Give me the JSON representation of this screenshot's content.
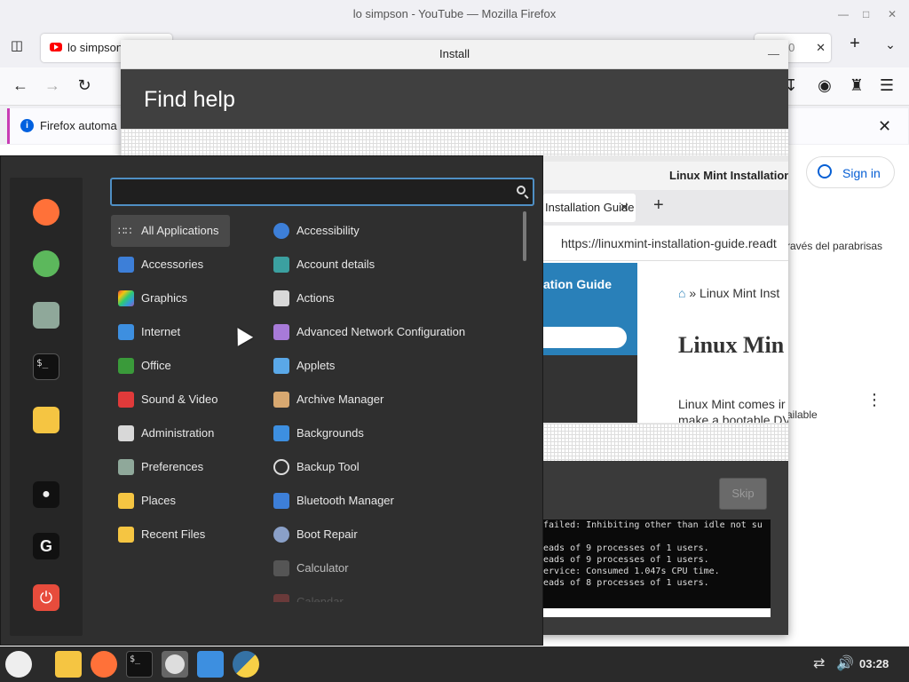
{
  "firefox": {
    "window_title": "lo simpson - YouTube — Mozilla Firefox",
    "tab_label": "lo simpson",
    "tab_partial": "t_20",
    "info_text": "Firefox automa",
    "sign_in": "Sign in",
    "stray_text_1": "ravés del parabrisas",
    "stray_text_2": "ailable"
  },
  "installer": {
    "title": "Install",
    "header": "Find help",
    "skip_label": "Skip",
    "guide": {
      "window_title": "Linux Mint Installation",
      "tab_label": "Installation Guide",
      "url": "https://linuxmint-installation-guide.readt",
      "sidebar_title": "ation Guide",
      "breadcrumb": "» Linux Mint Inst",
      "heading": "Linux Min",
      "paragraph_1": "Linux Mint comes ir",
      "paragraph_2": "make a bootable DV"
    },
    "terminal_lines": [
      "failed: Inhibiting other than idle not su",
      "",
      "eads of 9 processes of 1 users.",
      "eads of 9 processes of 1 users.",
      "ervice: Consumed 1.047s CPU time.",
      "eads of 8 processes of 1 users."
    ]
  },
  "menu": {
    "search": {
      "value": "",
      "placeholder": ""
    },
    "categories": [
      {
        "label": "All Applications"
      },
      {
        "label": "Accessories"
      },
      {
        "label": "Graphics"
      },
      {
        "label": "Internet"
      },
      {
        "label": "Office"
      },
      {
        "label": "Sound & Video"
      },
      {
        "label": "Administration"
      },
      {
        "label": "Preferences"
      },
      {
        "label": "Places"
      },
      {
        "label": "Recent Files"
      }
    ],
    "apps": [
      {
        "label": "Accessibility"
      },
      {
        "label": "Account details"
      },
      {
        "label": "Actions"
      },
      {
        "label": "Advanced Network Configuration"
      },
      {
        "label": "Applets"
      },
      {
        "label": "Archive Manager"
      },
      {
        "label": "Backgrounds"
      },
      {
        "label": "Backup Tool"
      },
      {
        "label": "Bluetooth Manager"
      },
      {
        "label": "Boot Repair"
      },
      {
        "label": "Calculator"
      },
      {
        "label": "Calendar"
      }
    ]
  },
  "taskbar": {
    "clock": "03:28"
  },
  "colors": {
    "accent": "#4f8fc4",
    "menu_bg": "#2f2f2f",
    "installer_header": "#404040",
    "guide_blue": "#2980b9",
    "firefox_orange": "#ff7139",
    "power_red": "#e74c3c"
  }
}
